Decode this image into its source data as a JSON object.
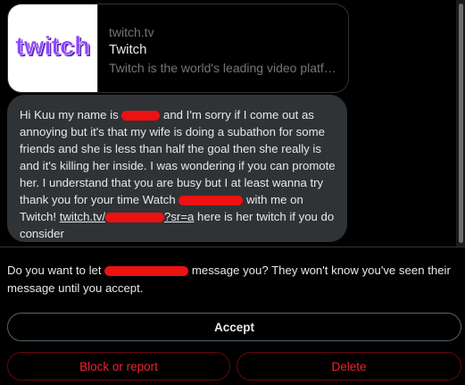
{
  "link_card": {
    "domain": "twitch.tv",
    "title": "Twitch",
    "description": "Twitch is the world's leading video platform and community for gamers.",
    "logo_text": "twitch",
    "logo_color": "#9146ff"
  },
  "message": {
    "seg1": "Hi Kuu my name is ",
    "seg2": " and I'm sorry if I come out as annoying but it's that my wife is doing a subathon for some friends and she is less than half the goal then she really is and it's killing her inside. I was wondering if you can promote her. I understand that you are busy but I at least wanna try thank you for your time Watch ",
    "seg3": " with me on Twitch! ",
    "link_prefix": "twitch.tv/",
    "link_suffix": "?sr=a",
    "seg4": " here is her twitch if you do consider"
  },
  "request": {
    "prompt_start": "Do you want to let ",
    "prompt_end": " message you? They won't know you've seen their message until you accept."
  },
  "actions": {
    "accept": "Accept",
    "block": "Block or report",
    "delete": "Delete"
  },
  "colors": {
    "background": "#000000",
    "bubble": "#2f3336",
    "danger": "#f4212e",
    "redaction": "#ee1111"
  }
}
